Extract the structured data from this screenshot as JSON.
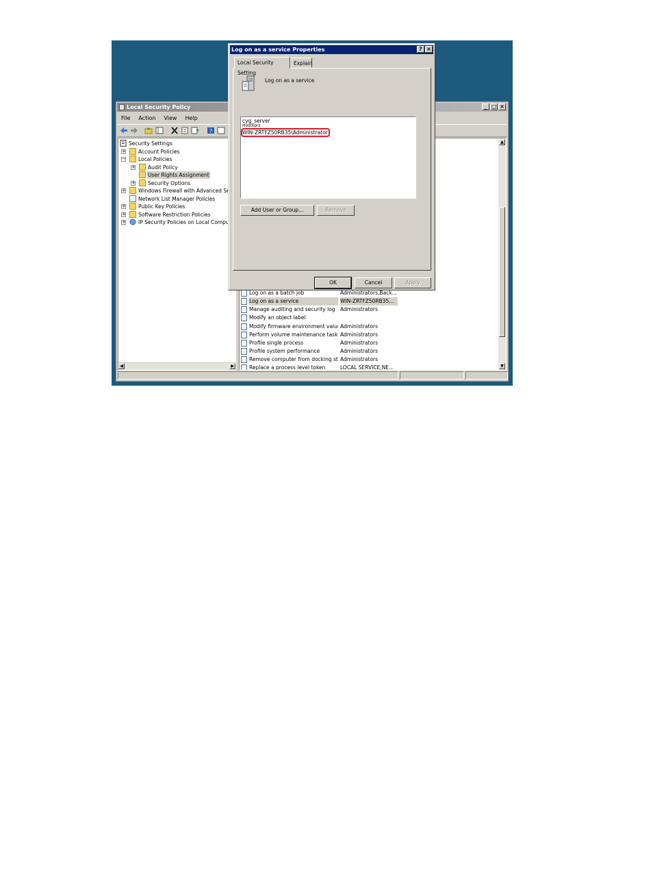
{
  "mmc": {
    "title": "Local Security Policy",
    "menu": [
      "File",
      "Action",
      "View",
      "Help"
    ],
    "tree": [
      {
        "label": "Security Settings",
        "level": 0,
        "expander": ""
      },
      {
        "label": "Account Policies",
        "level": 1,
        "expander": "+"
      },
      {
        "label": "Local Policies",
        "level": 1,
        "expander": "−"
      },
      {
        "label": "Audit Policy",
        "level": 2,
        "expander": "+"
      },
      {
        "label": "User Rights Assignment",
        "level": 2,
        "expander": "",
        "selected": true
      },
      {
        "label": "Security Options",
        "level": 2,
        "expander": "+"
      },
      {
        "label": "Windows Firewall with Advanced Secu",
        "level": 1,
        "expander": "+"
      },
      {
        "label": "Network List Manager Policies",
        "level": 1,
        "expander": ""
      },
      {
        "label": "Public Key Policies",
        "level": 1,
        "expander": "+"
      },
      {
        "label": "Software Restriction Policies",
        "level": 1,
        "expander": "+"
      },
      {
        "label": "IP Security Policies on Local Computer",
        "level": 1,
        "expander": "+"
      }
    ],
    "policies": [
      {
        "name": "Log on as a batch job",
        "value": "Administrators,Back..."
      },
      {
        "name": "Log on as a service",
        "value": "WIN-ZRTFZ50RB35...",
        "selected": true
      },
      {
        "name": "Manage auditing and security log",
        "value": "Administrators"
      },
      {
        "name": "Modify an object label",
        "value": ""
      },
      {
        "name": "Modify firmware environment values",
        "value": "Administrators"
      },
      {
        "name": "Perform volume maintenance tasks",
        "value": "Administrators"
      },
      {
        "name": "Profile single process",
        "value": "Administrators"
      },
      {
        "name": "Profile system performance",
        "value": "Administrators"
      },
      {
        "name": "Remove computer from docking st...",
        "value": "Administrators"
      },
      {
        "name": "Replace a process level token",
        "value": "LOCAL SERVICE,NE..."
      }
    ]
  },
  "dialog": {
    "title": "Log on as a service Properties",
    "help_btn": "?",
    "close_btn": "×",
    "tabs": [
      "Local Security Setting",
      "Explain"
    ],
    "policy_name": "Log on as a service",
    "users": [
      "cyg_server",
      "Hostxprs",
      "WIN-ZRTFZ50RB35\\Administrator"
    ],
    "add_button": "Add User or Group...",
    "remove_button": "Remove",
    "ok_button": "OK",
    "cancel_button": "Cancel",
    "apply_button": "Apply"
  },
  "colors": {
    "desktop": "#1d5a7e",
    "dialog_title": "#0a246a",
    "highlight": "#e8132a"
  }
}
